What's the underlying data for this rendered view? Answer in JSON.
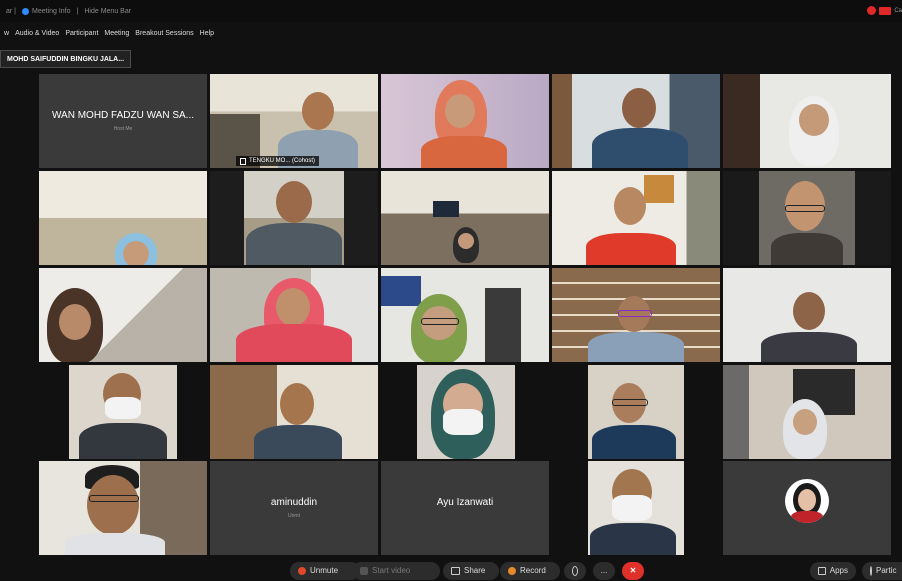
{
  "titlebar": {
    "left_text": "ar |",
    "meeting_info": "Meeting Info",
    "sep": "|",
    "hide_menu": "Hide Menu Bar"
  },
  "menu": [
    "w",
    "Audio & Video",
    "Participant",
    "Meeting",
    "Breakout Sessions",
    "Help"
  ],
  "active_speaker": "MOHD SAIFUDDIN BINGKU JALA...",
  "tiles": [
    {
      "id": "t1",
      "name": "WAN MOHD FADZU WAN SA...",
      "sub": "Host Me",
      "type": "name"
    },
    {
      "id": "t2",
      "label": "TENGKU MO... (Cohost)",
      "type": "video",
      "active": true
    },
    {
      "id": "t3",
      "type": "video"
    },
    {
      "id": "t4",
      "type": "video"
    },
    {
      "id": "t5",
      "type": "video"
    },
    {
      "id": "t6",
      "type": "video"
    },
    {
      "id": "t7",
      "type": "video"
    },
    {
      "id": "t8",
      "type": "video"
    },
    {
      "id": "t9",
      "type": "video"
    },
    {
      "id": "t10",
      "type": "video"
    },
    {
      "id": "t11",
      "type": "video"
    },
    {
      "id": "t12",
      "type": "video"
    },
    {
      "id": "t13",
      "type": "video"
    },
    {
      "id": "t14",
      "type": "video"
    },
    {
      "id": "t15",
      "type": "video"
    },
    {
      "id": "t16",
      "type": "video"
    },
    {
      "id": "t17",
      "type": "video"
    },
    {
      "id": "t18",
      "type": "video"
    },
    {
      "id": "t19",
      "type": "video"
    },
    {
      "id": "t20",
      "type": "video"
    },
    {
      "id": "t21",
      "type": "video"
    },
    {
      "id": "t22",
      "name": "aminuddin",
      "sub": "Unmt",
      "type": "name"
    },
    {
      "id": "t23",
      "name": "Ayu Izanwati",
      "type": "name"
    },
    {
      "id": "t24",
      "type": "video"
    },
    {
      "id": "t25",
      "type": "avatar"
    }
  ],
  "toolbar": {
    "unmute": "Unmute",
    "start_video": "Start video",
    "share": "Share",
    "record": "Record",
    "more": "...",
    "apps": "Apps",
    "participants": "Partic"
  },
  "colors": {
    "end_button": "#e0302a",
    "active_border": "#6bd38f",
    "record_red": "#e02828"
  }
}
